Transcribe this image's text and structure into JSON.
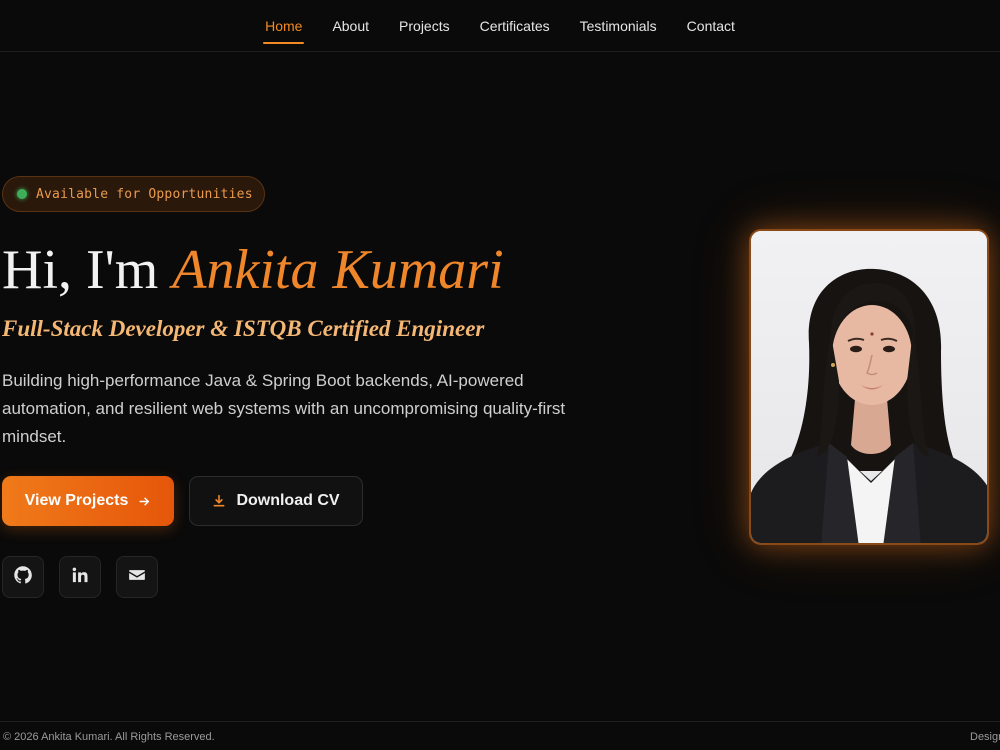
{
  "nav": {
    "items": [
      {
        "label": "Home",
        "active": true
      },
      {
        "label": "About"
      },
      {
        "label": "Projects"
      },
      {
        "label": "Certificates"
      },
      {
        "label": "Testimonials"
      },
      {
        "label": "Contact"
      }
    ],
    "accent_color": "#f28a24"
  },
  "hero": {
    "badge": "Available for Opportunities",
    "greeting": "Hi, I'm",
    "name": "Ankita Kumari",
    "subtitle": "Full-Stack Developer & ISTQB Certified Engineer",
    "description": "Building high-performance Java & Spring Boot backends, AI-powered automation, and resilient web systems with an uncompromising quality-first mindset.",
    "primary_button": "View Projects",
    "secondary_button": "Download CV",
    "socials": [
      "github-icon",
      "linkedin-icon",
      "mail-icon"
    ]
  },
  "footer": {
    "copyright": "© 2026 Ankita Kumari. All Rights Reserved.",
    "right_text": "Design"
  },
  "colors": {
    "background": "#0a0a0a",
    "accent": "#f0862a",
    "status_available": "#3fae5a"
  }
}
